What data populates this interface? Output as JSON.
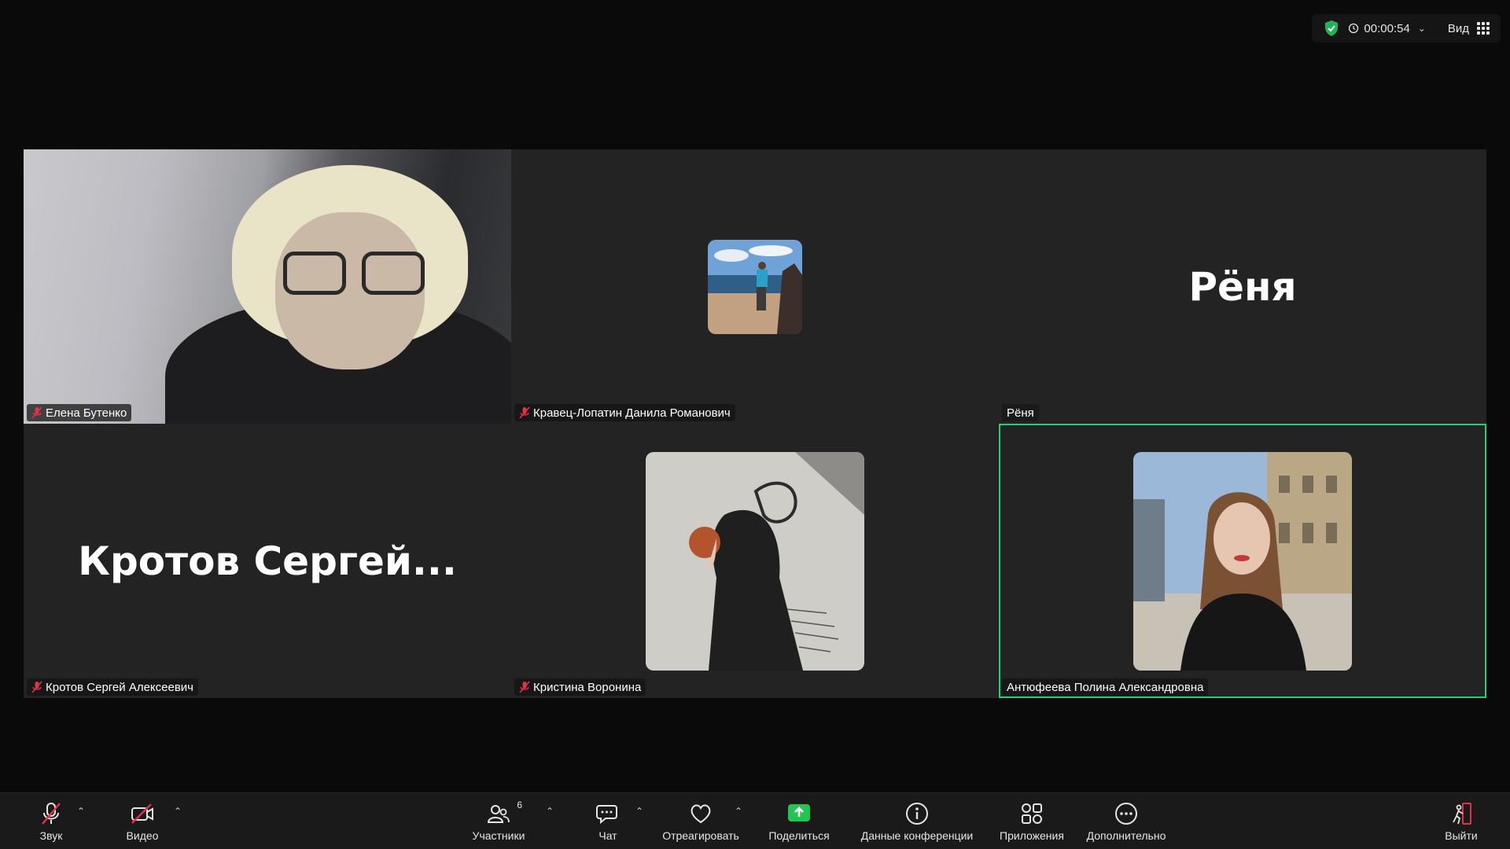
{
  "top_bar": {
    "timer": "00:00:54",
    "view_label": "Вид"
  },
  "participants": [
    {
      "name": "Елена Бутенко",
      "muted": true,
      "display": "video"
    },
    {
      "name": "Кравец-Лопатин Данила Романович",
      "muted": true,
      "display": "avatar"
    },
    {
      "name": "Рёня",
      "big_name": "Рёня",
      "muted": false,
      "display": "name"
    },
    {
      "name": "Кротов Сергей Алексеевич",
      "big_name": "Кротов  Сергей...",
      "muted": true,
      "display": "name"
    },
    {
      "name": "Кристина Воронина",
      "muted": true,
      "display": "avatar"
    },
    {
      "name": "Антюфеева Полина Александровна",
      "muted": false,
      "display": "avatar",
      "active_speaker": true
    }
  ],
  "toolbar": {
    "audio_label": "Звук",
    "video_label": "Видео",
    "participants_label": "Участники",
    "participants_count": "6",
    "chat_label": "Чат",
    "react_label": "Отреагировать",
    "share_label": "Поделиться",
    "meeting_info_label": "Данные конференции",
    "apps_label": "Приложения",
    "more_label": "Дополнительно",
    "leave_label": "Выйти"
  },
  "colors": {
    "active_speaker_border": "#22d07a",
    "share_green": "#23c552",
    "muted_red": "#e0334a",
    "shield_green": "#1fb45a"
  }
}
